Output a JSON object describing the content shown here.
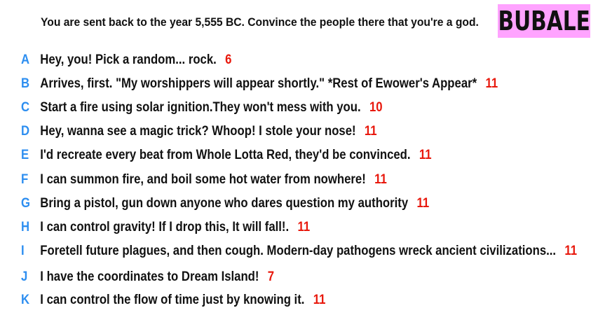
{
  "prompt": "You are sent back to the year 5,555 BC. Convince the people there that you're a god.",
  "badge": "BUBALE",
  "colors": {
    "badge_bg": "#ffa3ff",
    "letter": "#2d8ef0",
    "score": "#e8180c",
    "text": "#111111"
  },
  "answers": [
    {
      "letter": "A",
      "text": "Hey, you! Pick a random... rock.",
      "score": "6"
    },
    {
      "letter": "B",
      "text": "Arrives, first. \"My worshippers will appear shortly.\" *Rest of Ewower's Appear*",
      "score": "11"
    },
    {
      "letter": "C",
      "text": "Start a fire using solar ignition.They won't mess with you.",
      "score": "10"
    },
    {
      "letter": "D",
      "text": "Hey, wanna see a magic trick? Whoop! I stole your nose!",
      "score": "11"
    },
    {
      "letter": "E",
      "text": "I'd recreate every beat from Whole Lotta Red, they'd be convinced.",
      "score": "11"
    },
    {
      "letter": "F",
      "text": "I can summon fire, and boil some hot water from nowhere!",
      "score": "11"
    },
    {
      "letter": "G",
      "text": "Bring a pistol, gun down anyone who dares question my authority",
      "score": "11"
    },
    {
      "letter": "H",
      "text": "I can control gravity! If I drop this, It will fall!.",
      "score": "11"
    },
    {
      "letter": "I",
      "text": "Foretell future plagues, and then cough. Modern-day pathogens wreck ancient civilizations...",
      "score": "11"
    },
    {
      "letter": "J",
      "text": "I have the coordinates to Dream Island!",
      "score": "7"
    },
    {
      "letter": "K",
      "text": "I can control the flow of time just by knowing it.",
      "score": "11"
    }
  ]
}
